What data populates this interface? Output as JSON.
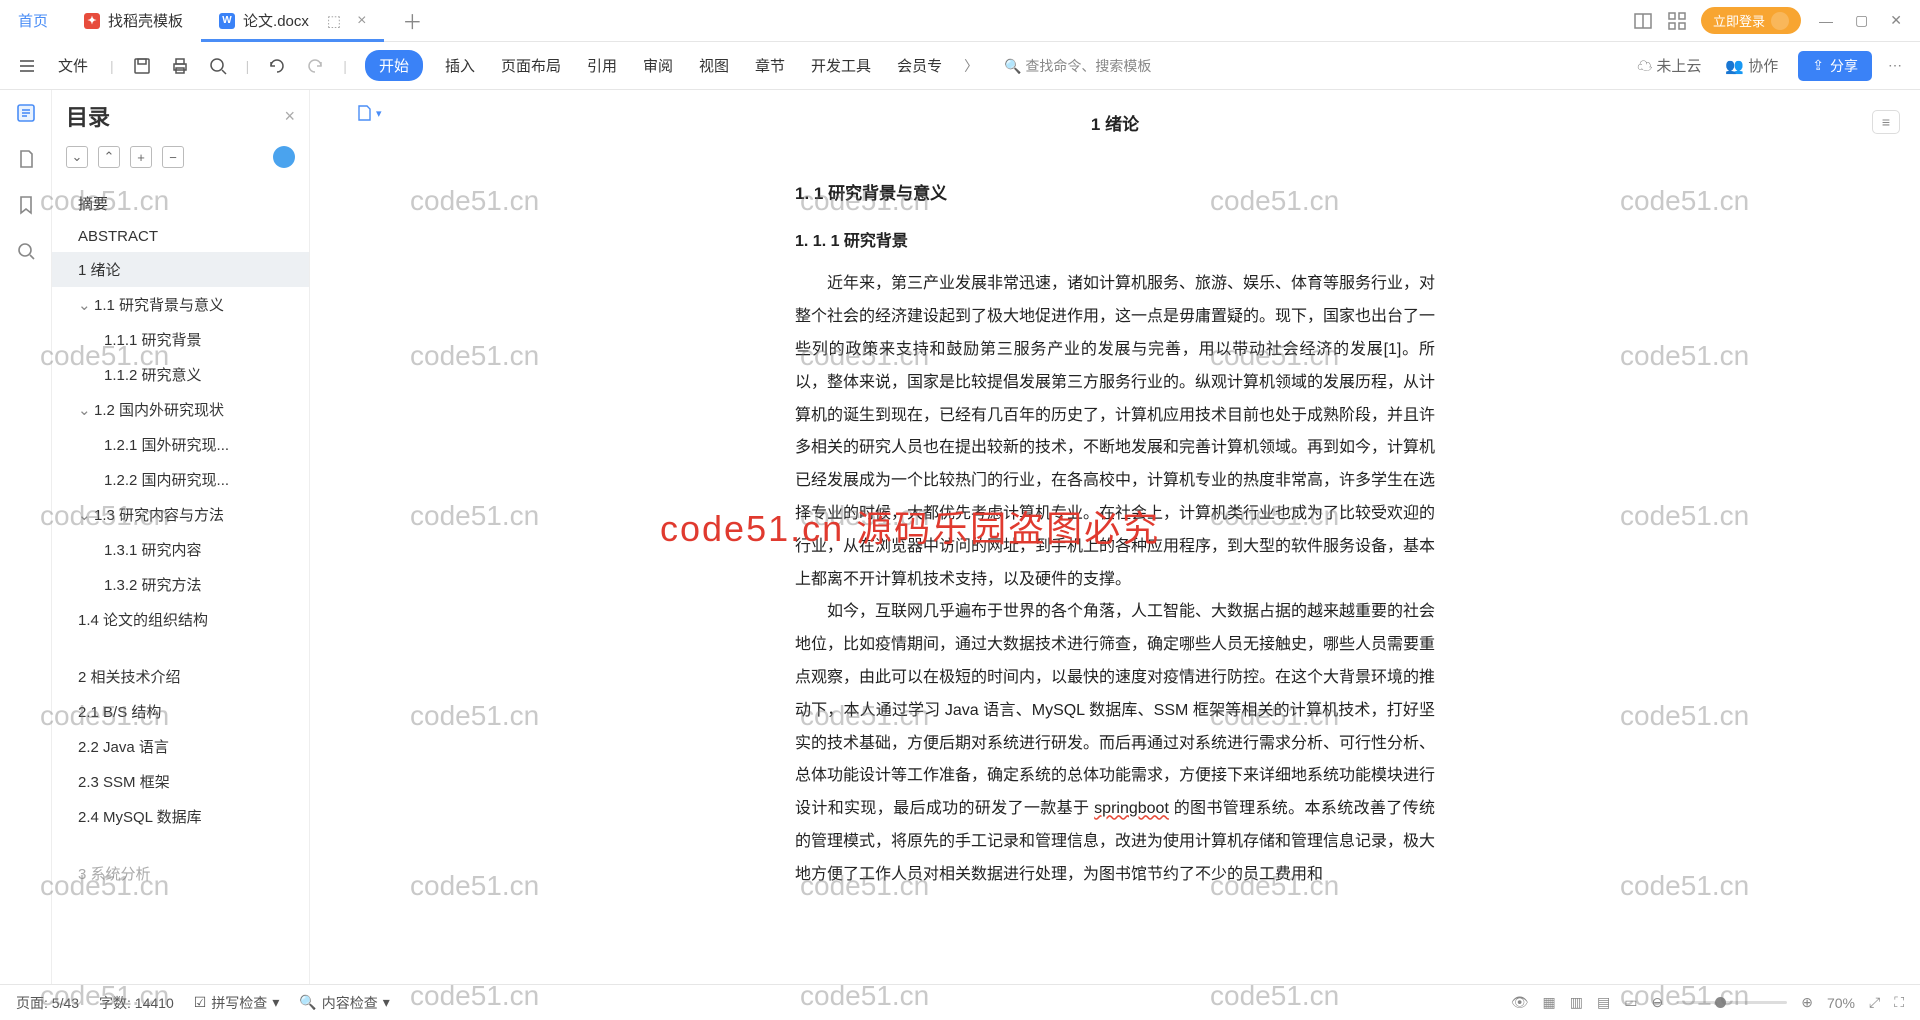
{
  "tabs": {
    "home": "首页",
    "template": "找稻壳模板",
    "doc": "论文.docx"
  },
  "login": "立即登录",
  "menu": {
    "file": "文件",
    "start": "开始",
    "insert": "插入",
    "layout": "页面布局",
    "ref": "引用",
    "review": "审阅",
    "view": "视图",
    "chapter": "章节",
    "devtools": "开发工具",
    "member": "会员专",
    "search": "查找命令、搜索模板",
    "cloud": "未上云",
    "coop": "协作",
    "share": "分享"
  },
  "outline": {
    "title": "目录",
    "items": [
      {
        "t": "摘要",
        "lv": 1
      },
      {
        "t": "ABSTRACT",
        "lv": 1
      },
      {
        "t": "1 绪论",
        "lv": 1,
        "sel": true
      },
      {
        "t": "1.1 研究背景与意义",
        "lv": 2,
        "chev": true
      },
      {
        "t": "1.1.1 研究背景",
        "lv": 3
      },
      {
        "t": "1.1.2 研究意义",
        "lv": 3
      },
      {
        "t": "1.2 国内外研究现状",
        "lv": 2,
        "chev": true
      },
      {
        "t": "1.2.1 国外研究现...",
        "lv": 3
      },
      {
        "t": "1.2.2 国内研究现...",
        "lv": 3
      },
      {
        "t": "1.3 研究内容与方法",
        "lv": 2,
        "chev": true
      },
      {
        "t": "1.3.1 研究内容",
        "lv": 3
      },
      {
        "t": "1.3.2 研究方法",
        "lv": 3
      },
      {
        "t": "1.4 论文的组织结构",
        "lv": 2
      },
      {
        "t": "2 相关技术介绍",
        "lv": 1,
        "sep": true
      },
      {
        "t": "2.1 B/S 结构",
        "lv": 2
      },
      {
        "t": "2.2 Java 语言",
        "lv": 2
      },
      {
        "t": "2.3 SSM 框架",
        "lv": 2
      },
      {
        "t": "2.4 MySQL 数据库",
        "lv": 2
      },
      {
        "t": "3 系统分析",
        "lv": 1,
        "faded": true,
        "sep": true
      }
    ]
  },
  "doc": {
    "h1": "1 绪论",
    "h2": "1. 1 研究背景与意义",
    "h3": "1. 1. 1 研究背景",
    "p1": "近年来，第三产业发展非常迅速，诸如计算机服务、旅游、娱乐、体育等服务行业，对整个社会的经济建设起到了极大地促进作用，这一点是毋庸置疑的。现下，国家也出台了一些列的政策来支持和鼓励第三服务产业的发展与完善，用以带动社会经济的发展[1]。所以，整体来说，国家是比较提倡发展第三方服务行业的。纵观计算机领域的发展历程，从计算机的诞生到现在，已经有几百年的历史了，计算机应用技术目前也处于成熟阶段，并且许多相关的研究人员也在提出较新的技术，不断地发展和完善计算机领域。再到如今，计算机已经发展成为一个比较热门的行业，在各高校中，计算机专业的热度非常高，许多学生在选择专业的时候，大都优先考虑计算机专业。在社会上，计算机类行业也成为了比较受欢迎的行业，从在浏览器中访问的网址，到手机上的各种应用程序，到大型的软件服务设备，基本上都离不开计算机技术支持，以及硬件的支撑。",
    "p2a": "如今，互联网几乎遍布于世界的各个角落，人工智能、大数据占据的越来越重要的社会地位，比如疫情期间，通过大数据技术进行筛查，确定哪些人员无接触史，哪些人员需要重点观察，由此可以在极短的时间内，以最快的速度对疫情进行防控。在这个大背景环境的推动下，本人通过学习 Java 语言、MySQL 数据库、SSM 框架等相关的计算机技术，打好坚实的技术基础，方便后期对系统进行研发。而后再通过对系统进行需求分析、可行性分析、总体功能设计等工作准备，确定系统的总体功能需求，方便接下来详细地系统功能模块进行设计和实现，最后成功的研发了一款基于 ",
    "sb": "springboot",
    "p2b": " 的图书管理系统。本系统改善了传统的管理模式，将原先的手工记录和管理信息，改进为使用计算机存储和管理信息记录，极大地方便了工作人员对相关数据进行处理，为图书馆节约了不少的员工费用和"
  },
  "status": {
    "page": "页面: 5/43",
    "words": "字数: 14410",
    "spell": "拼写检查",
    "content": "内容检查",
    "zoom": "70%"
  },
  "watermarks": {
    "text": "code51.cn",
    "red": "code51.cn 源码乐园盗图必究"
  }
}
